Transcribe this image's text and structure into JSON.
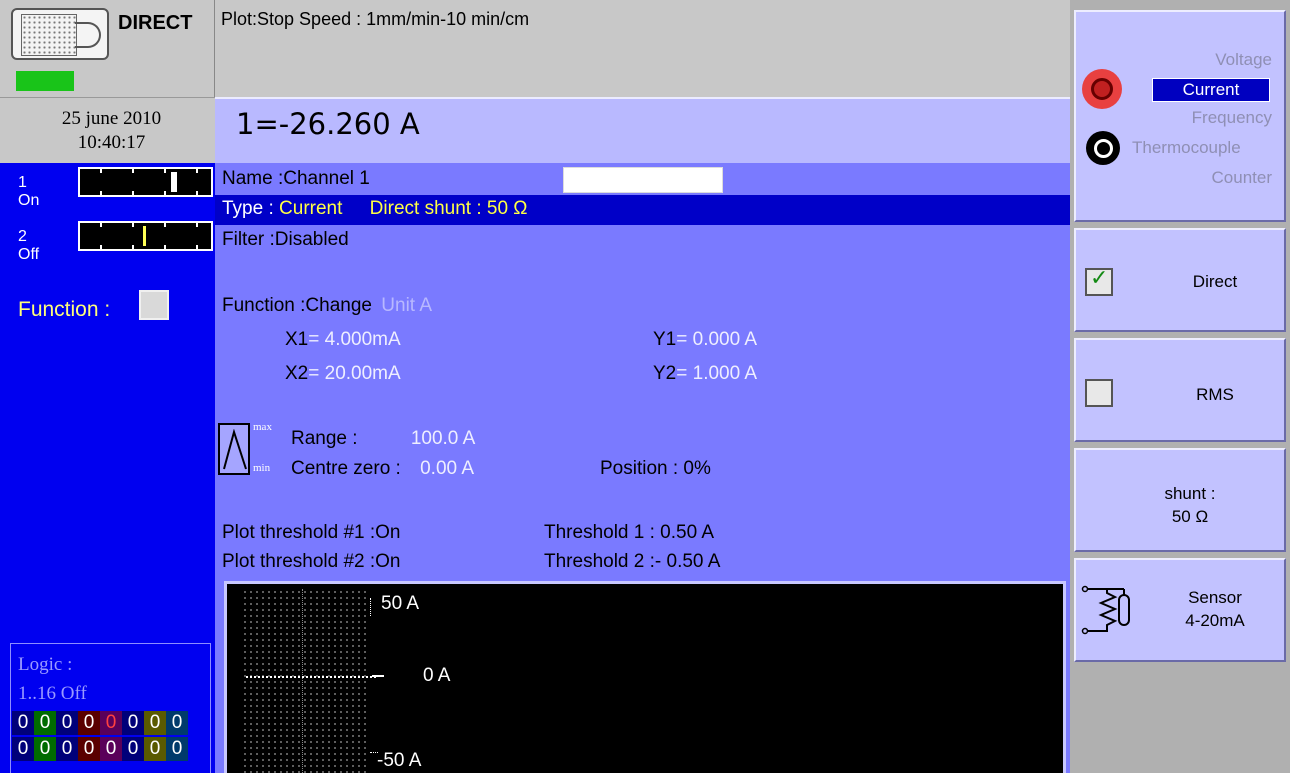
{
  "header": {
    "mode": "DIRECT",
    "plot_status": "Plot:Stop  Speed : 1mm/min-10 min/cm"
  },
  "datetime": {
    "date": "25 june 2010",
    "time": "10:40:17"
  },
  "measurement": {
    "value": "1=-26.260  A"
  },
  "channels": [
    {
      "label": "1 On",
      "state_color": "#ffffff"
    },
    {
      "label": "2 Off",
      "state_color": "#ffff55"
    }
  ],
  "function_label": "Function :",
  "logic": {
    "label": "Logic :",
    "range": "1..16   Off",
    "bits_row1": [
      "0",
      "0",
      "0",
      "0",
      "0",
      "0",
      "0",
      "0"
    ],
    "bits_row2": [
      "0",
      "0",
      "0",
      "0",
      "0",
      "0",
      "0",
      "0"
    ]
  },
  "config": {
    "name_label": "Name :Channel 1",
    "name_value": "",
    "type_label": "Type :",
    "type_value": "Current",
    "shunt_label": "Direct shunt : 50 Ω",
    "filter": "Filter :Disabled",
    "function_line": "Function :Change",
    "unit_label": "Unit",
    "unit_value": "A",
    "x1_label": "X1",
    "x1_value": "= 4.000mA",
    "x2_label": "X2",
    "x2_value": "= 20.00mA",
    "y1_label": "Y1",
    "y1_value": "= 0.000 A",
    "y2_label": "Y2",
    "y2_value": "= 1.000 A",
    "max_tag": "max",
    "min_tag": "min",
    "range_label": "Range   :",
    "range_value": "100.0 A",
    "centre_label": "Centre zero :",
    "centre_value": "0.00 A",
    "position_label": "Position : 0%",
    "plot_threshold_1": "Plot threshold #1 :On",
    "plot_threshold_2": "Plot threshold #2 :On",
    "threshold_1": "Threshold 1 :  0.50 A",
    "threshold_2": "Threshold 2 :- 0.50 A"
  },
  "scope": {
    "top_label": "50 A",
    "zero_label": "0 A",
    "bottom_label": "-50 A"
  },
  "menu": {
    "input_options": [
      "Voltage",
      "Current",
      "Frequency",
      "Thermocouple",
      "Counter"
    ],
    "selected_input": "Current",
    "direct_label": "Direct",
    "direct_checked": true,
    "rms_label": "RMS",
    "rms_checked": false,
    "shunt_line1": "shunt :",
    "shunt_line2": "50 Ω",
    "sensor_line1": "Sensor",
    "sensor_line2": "4-20mA"
  },
  "colors": {
    "left_panel": "#0000f0",
    "center_panel": "#7a7aff",
    "highlight_row": "#0000c8",
    "menu_button": "#c2c2ff",
    "status_led": "#19c419"
  }
}
